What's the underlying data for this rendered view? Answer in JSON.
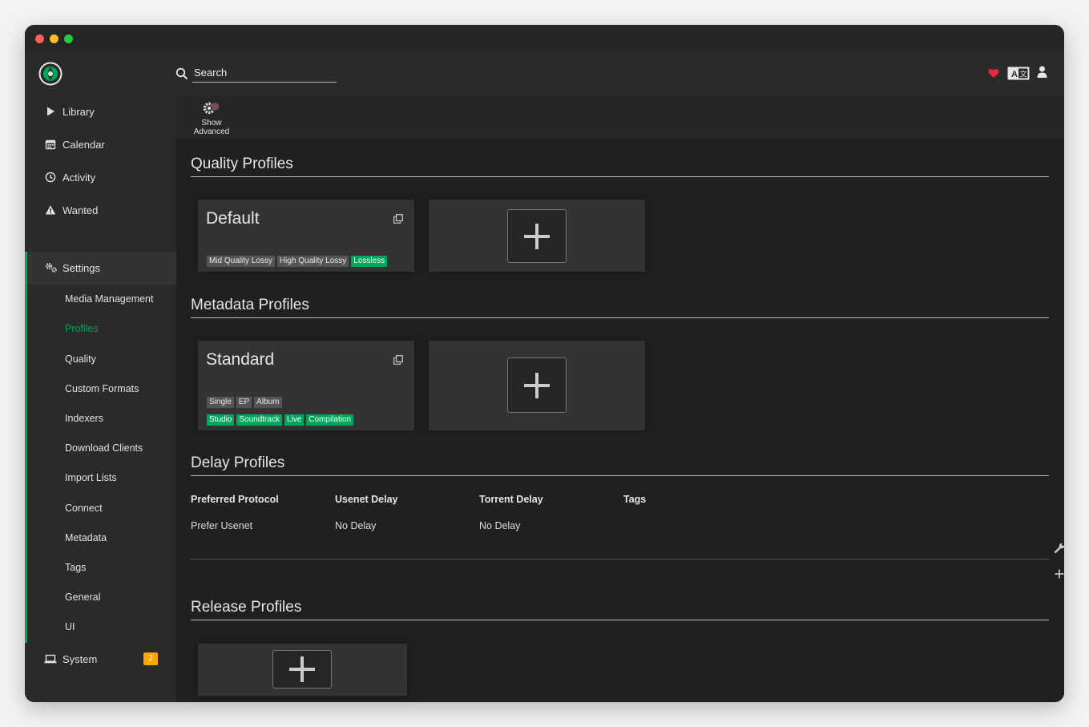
{
  "header": {
    "search_placeholder": "Search"
  },
  "sidebar": {
    "items": [
      {
        "label": "Library",
        "icon": "play-icon"
      },
      {
        "label": "Calendar",
        "icon": "calendar-icon"
      },
      {
        "label": "Activity",
        "icon": "clock-icon"
      },
      {
        "label": "Wanted",
        "icon": "warning-icon"
      },
      {
        "label": "Settings",
        "icon": "cogs-icon"
      },
      {
        "label": "System",
        "icon": "laptop-icon",
        "badge": "2"
      }
    ],
    "settings_children": [
      {
        "label": "Media Management"
      },
      {
        "label": "Profiles"
      },
      {
        "label": "Quality"
      },
      {
        "label": "Custom Formats"
      },
      {
        "label": "Indexers"
      },
      {
        "label": "Download Clients"
      },
      {
        "label": "Import Lists"
      },
      {
        "label": "Connect"
      },
      {
        "label": "Metadata"
      },
      {
        "label": "Tags"
      },
      {
        "label": "General"
      },
      {
        "label": "UI"
      }
    ]
  },
  "toolbar": {
    "show_advanced_line1": "Show",
    "show_advanced_line2": "Advanced"
  },
  "quality_profiles": {
    "title": "Quality Profiles",
    "cards": [
      {
        "name": "Default",
        "tags": [
          "Mid Quality Lossy",
          "High Quality Lossy"
        ],
        "green_tags": [
          "Lossless"
        ]
      }
    ]
  },
  "metadata_profiles": {
    "title": "Metadata Profiles",
    "cards": [
      {
        "name": "Standard",
        "tags": [
          "Single",
          "EP",
          "Album"
        ],
        "green_tags": [
          "Studio",
          "Soundtrack",
          "Live",
          "Compilation"
        ]
      }
    ]
  },
  "delay_profiles": {
    "title": "Delay Profiles",
    "columns": [
      "Preferred Protocol",
      "Usenet Delay",
      "Torrent Delay",
      "Tags"
    ],
    "rows": [
      {
        "protocol": "Prefer Usenet",
        "usenet_delay": "No Delay",
        "torrent_delay": "No Delay",
        "tags": ""
      }
    ]
  },
  "release_profiles": {
    "title": "Release Profiles"
  },
  "colors": {
    "accent": "#00a65b",
    "badge": "#ffa500",
    "heart": "#e8283e"
  }
}
